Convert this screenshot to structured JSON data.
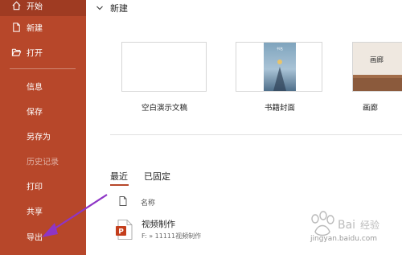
{
  "sidebar": {
    "items": [
      {
        "label": "开始",
        "icon": "home-icon"
      },
      {
        "label": "新建",
        "icon": "new-file-icon"
      },
      {
        "label": "打开",
        "icon": "folder-open-icon"
      },
      {
        "label": "信息"
      },
      {
        "label": "保存"
      },
      {
        "label": "另存为"
      },
      {
        "label": "历史记录"
      },
      {
        "label": "打印"
      },
      {
        "label": "共享"
      },
      {
        "label": "导出"
      }
    ]
  },
  "main": {
    "new_title": "新建",
    "templates": [
      {
        "label": "空白演示文稿"
      },
      {
        "label": "书籍封面",
        "thumb_title": "书名"
      },
      {
        "label": "画廊",
        "thumb_title": "画廊"
      }
    ],
    "tabs": [
      {
        "label": "最近"
      },
      {
        "label": "已固定"
      }
    ],
    "list_header": {
      "name_col": "名称"
    },
    "files": [
      {
        "name": "视频制作",
        "path": "F: » 11111视频制作"
      }
    ]
  },
  "watermark": {
    "text": "jingyan.baidu.com"
  },
  "colors": {
    "accent": "#b7472a",
    "annotation": "#8e35c6"
  }
}
